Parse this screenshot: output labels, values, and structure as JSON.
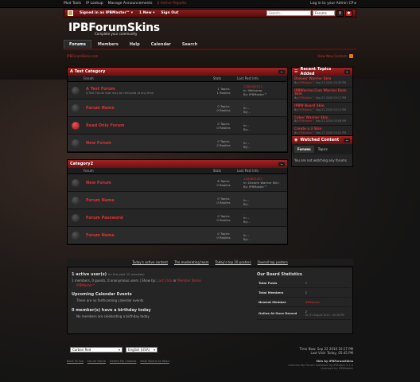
{
  "topbar": {
    "links": [
      "Mod Tools",
      "IP Lookup",
      "Manage Announcements"
    ],
    "reports": "2 Active Reports",
    "right": "Log in to your Admin CP ▸"
  },
  "userbar": {
    "signed_in": "Signed in as IPBMaster™ ▾",
    "new_count": "1 New ▾",
    "sign_out": "Sign Out",
    "search_placeholder": "Search...",
    "search_scope": "Forums"
  },
  "header": {
    "logo": "IPBForumSkins",
    "slogan": "Complete your community"
  },
  "nav": [
    "Forums",
    "Members",
    "Help",
    "Calendar",
    "Search"
  ],
  "crumb": "IPBForumSkins.com",
  "view_new": "View New Content",
  "categories": [
    {
      "title": "A Test Category",
      "cols": {
        "forum": "Forum",
        "stats": "Stats",
        "last": "Last Post Info"
      },
      "rows": [
        {
          "name": "A Test Forum",
          "desc": "A Test Forum that may be removed at any time",
          "stats1": "1 Topics",
          "stats2": "1 Replies",
          "l1": "1284482211",
          "l2": "In: Welcome",
          "l3": "By: IPBMaster™",
          "icon": "dark"
        },
        {
          "name": "Forum Name",
          "desc": "",
          "stats1": "0 Topics",
          "stats2": "0 Replies",
          "l1": "-",
          "l2": "In: -",
          "l3": "By: -",
          "icon": "dark"
        },
        {
          "name": "Read Only Forum",
          "desc": "",
          "stats1": "0 Topics",
          "stats2": "0 Replies",
          "l1": "-",
          "l2": "In: -",
          "l3": "By: -",
          "icon": "red"
        },
        {
          "name": "New Forum",
          "desc": "",
          "stats1": "0 Topics",
          "stats2": "0 Replies",
          "l1": "-",
          "l2": "In: -",
          "l3": "By: -",
          "icon": "dark"
        }
      ]
    },
    {
      "title": "Category2",
      "cols": {
        "forum": "Forum",
        "stats": "Stats",
        "last": "Last Post Info"
      },
      "rows": [
        {
          "name": "New Forum",
          "desc": "",
          "stats1": "6 Topics",
          "stats2": "0 Replies",
          "l1": "1284651457",
          "l2": "In: Dreamr Warrior Skin",
          "l3": "By: IPBMaster™",
          "icon": "dark"
        },
        {
          "name": "Forum Name",
          "desc": "",
          "stats1": "0 Topics",
          "stats2": "0 Replies",
          "l1": "-",
          "l2": "In: -",
          "l3": "By: -",
          "icon": "dark"
        },
        {
          "name": "Forum Password",
          "desc": "",
          "stats1": "0 Topics",
          "stats2": "0 Replies",
          "l1": "-",
          "l2": "In: -",
          "l3": "By: -",
          "icon": "dark"
        },
        {
          "name": "Forum Name",
          "desc": "",
          "stats1": "0 Topics",
          "stats2": "0 Replies",
          "l1": "-",
          "l2": "In: -",
          "l3": "By: -",
          "icon": "dark"
        }
      ]
    }
  ],
  "recent": {
    "title": "Recent Topics Added",
    "items": [
      {
        "t": "Dreamr Warrior Skin",
        "by": "IPBMaster™",
        "d": "Sep 23 2010 05:35 PM"
      },
      {
        "t": "IPBWarrior.Com Warrior Dark Skin",
        "by": "IPBMaster™",
        "d": "Sep 22 2010 05:17 PM"
      },
      {
        "t": "IPBW Board Skin",
        "by": "IPBMaster™",
        "d": "Sep 22 2010 05:12 PM"
      },
      {
        "t": "Cyber Warrior Skin",
        "by": "IPBMaster™",
        "d": "Sep 22 2010 05:08 PM"
      },
      {
        "t": "Create a 3 Skin",
        "by": "IPBMaster™",
        "d": "Sep 22 2010 05:01 PM"
      }
    ]
  },
  "watched": {
    "title": "Watched Content",
    "tabs": [
      "Forums",
      "Topics"
    ],
    "note": "You are not watching any forums"
  },
  "statsbar": [
    "Today's active content",
    "The moderating team",
    "Today's top 20 posters",
    "Overall top posters"
  ],
  "board": {
    "active_title": "1 active user(s)",
    "active_suffix": "(in the past 15 minutes)",
    "active_line": "1 members, 0 guests, 0 anonymous users",
    "show_by": "| Show by:",
    "last_click": "Last Click",
    "or": "or",
    "member_name": "Member Name",
    "active_member": "IPBMaster™",
    "events_title": "Upcoming Calendar Events",
    "events_text": "There are no forthcoming calendar events",
    "bday_title": "0 member(s) have a birthday today",
    "bday_text": "No members are celebrating a birthday today",
    "stats_title": "Our Board Statistics",
    "stats": [
      {
        "k": "Total Posts",
        "v": "7"
      },
      {
        "k": "Total Members",
        "v": "2"
      },
      {
        "k": "Newest Member",
        "v": "IPBMaster"
      },
      {
        "k": "Online At Once Record",
        "v": "2"
      }
    ],
    "record_date": "On 31 August 2010 - 05:38 PM"
  },
  "footer": {
    "skin": "Carbon Red",
    "lang": "English (USA)",
    "time1": "Time Now: Sep 22 2010 10:17 PM",
    "time2": "Last Visit: Today, 05:45 PM",
    "links": [
      "Back To Top",
      "Forum Home",
      "Delete My Cookies",
      "Mark Board As Read"
    ],
    "copy1": "Skin by IPBForumSkins",
    "copy2": "Community Forum Software by IP.Board 3.1.2",
    "copy3": "Licensed to: IPBMaster"
  }
}
